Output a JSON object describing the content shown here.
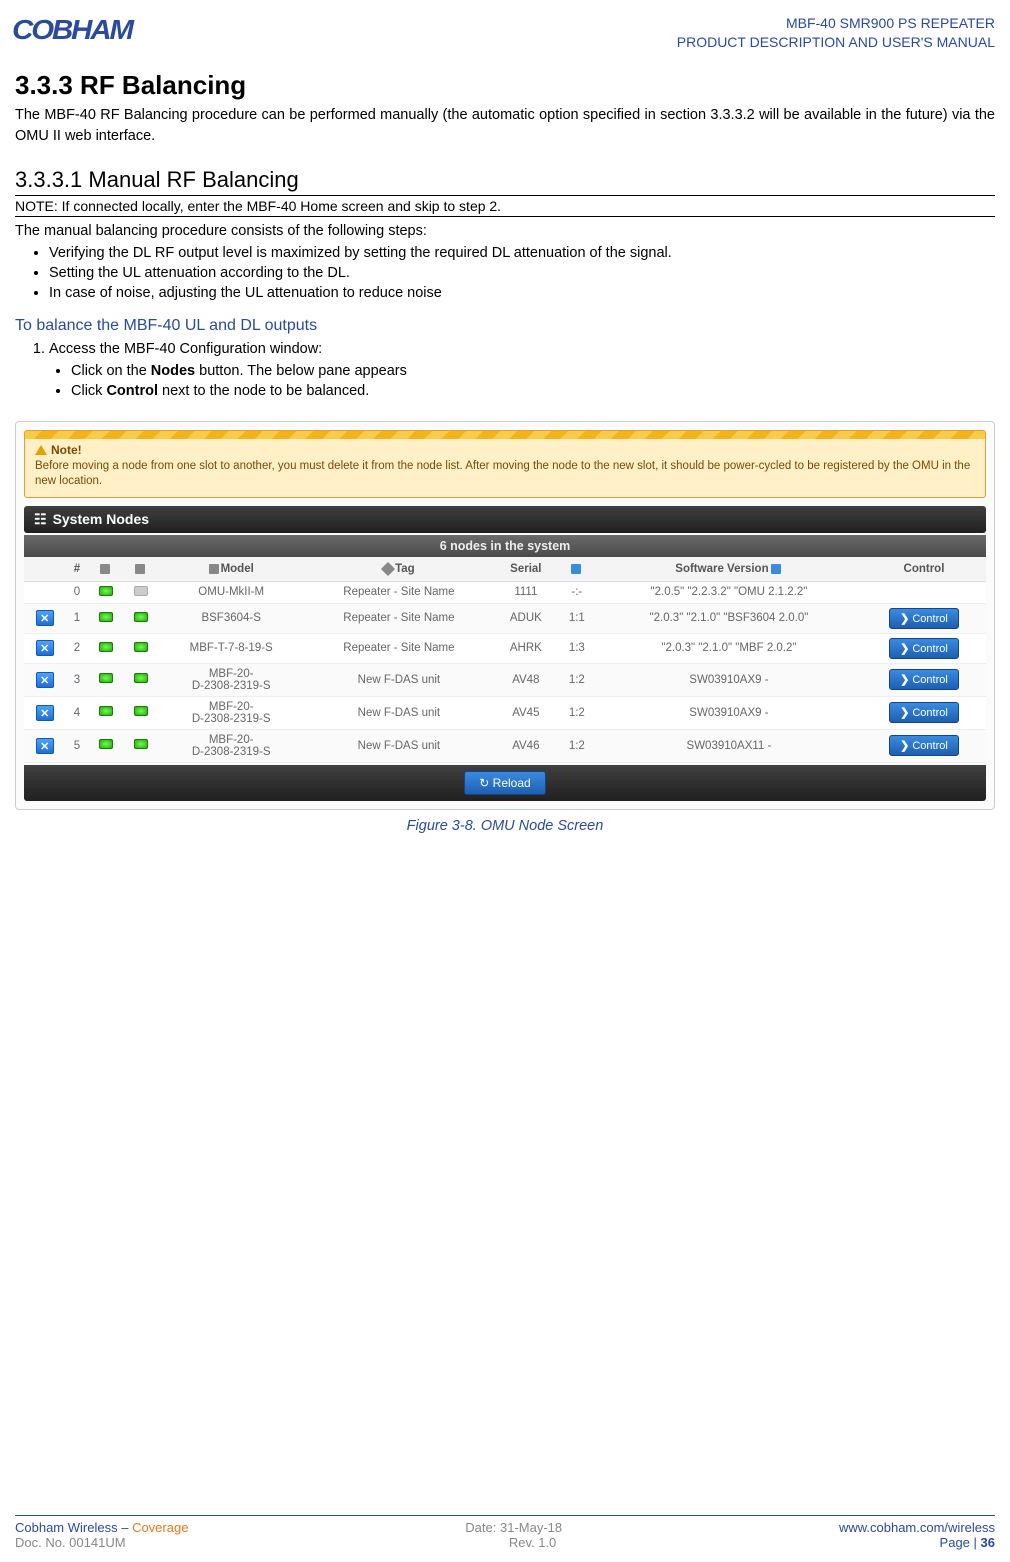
{
  "header": {
    "logo": "COBHAM",
    "line1": "MBF-40 SMR900 PS REPEATER",
    "line2": "PRODUCT DESCRIPTION AND USER'S MANUAL"
  },
  "section": {
    "num_title": "3.3.3  RF Balancing",
    "intro": "The MBF-40 RF Balancing procedure can be performed manually (the automatic option specified in section 3.3.3.2 will be available in the future) via the OMU II web interface.",
    "sub_num_title": "3.3.3.1  Manual RF Balancing",
    "note": "NOTE: If connected locally, enter the MBF-40 Home screen and skip to step 2.",
    "consists": "The manual balancing procedure consists of the following steps:",
    "bullets": [
      "Verifying the DL RF output level is maximized by setting the required DL attenuation of the signal.",
      "Setting the UL attenuation according to the DL.",
      "In case of noise, adjusting the UL attenuation to reduce noise"
    ],
    "blue_head": "To balance the MBF-40 UL and DL outputs",
    "step1": "Access the MBF-40 Configuration window:",
    "step1_sub_a_pre": "Click on the ",
    "step1_sub_a_bold": "Nodes",
    "step1_sub_a_post": " button. The below pane appears",
    "step1_sub_b_pre": "Click ",
    "step1_sub_b_bold": "Control",
    "step1_sub_b_post": " next to the node to be balanced."
  },
  "figure": {
    "note_title": "Note!",
    "note_body": "Before moving a node from one slot to another, you must delete it from the node list. After moving the node to the new slot, it should be power-cycled to be registered by the OMU in the new location.",
    "sysnodes_label": "System Nodes",
    "count_label": "6 nodes in the system",
    "headers": {
      "hash": "#",
      "a": "",
      "b": "",
      "model": "Model",
      "tag": "Tag",
      "serial": "Serial",
      "slot": "",
      "sw": "Software Version",
      "control": "Control"
    },
    "rows": [
      {
        "del": false,
        "led1": "on",
        "led2": "off",
        "n": "0",
        "model": "OMU-MkII-M",
        "tag": "Repeater - Site Name",
        "serial": "1111",
        "slot": "-:-",
        "sw": "\"2.0.5\" \"2.2.3.2\" \"OMU 2.1.2.2\"",
        "ctrl": false
      },
      {
        "del": true,
        "led1": "on",
        "led2": "on",
        "n": "1",
        "model": "BSF3604-S",
        "tag": "Repeater - Site Name",
        "serial": "ADUK",
        "slot": "1:1",
        "sw": "\"2.0.3\" \"2.1.0\" \"BSF3604 2.0.0\"",
        "ctrl": true
      },
      {
        "del": true,
        "led1": "on",
        "led2": "on",
        "n": "2",
        "model": "MBF-T-7-8-19-S",
        "tag": "Repeater - Site Name",
        "serial": "AHRK",
        "slot": "1:3",
        "sw": "\"2.0.3\" \"2.1.0\" \"MBF 2.0.2\"",
        "ctrl": true
      },
      {
        "del": true,
        "led1": "on",
        "led2": "on",
        "n": "3",
        "model": "MBF-20-\nD-2308-2319-S",
        "tag": "New F-DAS unit",
        "serial": "AV48",
        "slot": "1:2",
        "sw": "SW03910AX9 -",
        "ctrl": true
      },
      {
        "del": true,
        "led1": "on",
        "led2": "on",
        "n": "4",
        "model": "MBF-20-\nD-2308-2319-S",
        "tag": "New F-DAS unit",
        "serial": "AV45",
        "slot": "1:2",
        "sw": "SW03910AX9 -",
        "ctrl": true
      },
      {
        "del": true,
        "led1": "on",
        "led2": "on",
        "n": "5",
        "model": "MBF-20-\nD-2308-2319-S",
        "tag": "New F-DAS unit",
        "serial": "AV46",
        "slot": "1:2",
        "sw": "SW03910AX11 -",
        "ctrl": true
      }
    ],
    "reload": "Reload",
    "control_label": "Control",
    "caption": "Figure 3-8. OMU Node Screen"
  },
  "footer": {
    "l1a": "Cobham Wireless",
    "l1dash": " – ",
    "l1b": "Coverage",
    "l1c": "Date: 31-May-18",
    "l1d": "www.cobham.com/wireless",
    "l2a": "Doc. No. 00141UM",
    "l2b": "Rev. 1.0",
    "l2c_pre": "Page | ",
    "l2c_num": "36"
  }
}
